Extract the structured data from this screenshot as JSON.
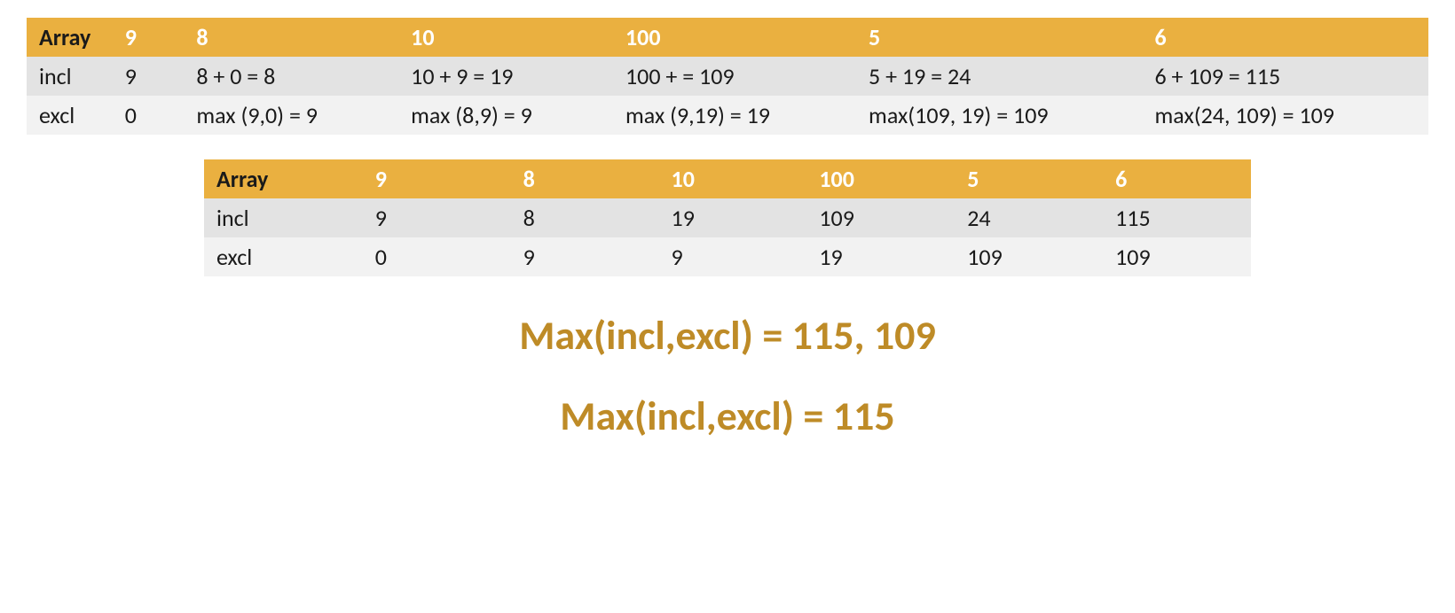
{
  "table1": {
    "header": [
      "Array",
      "9",
      "8",
      "10",
      "100",
      "5",
      "6"
    ],
    "rows": [
      [
        "incl",
        "9",
        "8 + 0 = 8",
        "10 + 9 = 19",
        "100 +  = 109",
        "5 + 19 = 24",
        "6 + 109 = 115"
      ],
      [
        "excl",
        "0",
        "max (9,0) = 9",
        "max (8,9) = 9",
        "max (9,19) = 19",
        "max(109, 19) = 109",
        "max(24, 109) = 109"
      ]
    ]
  },
  "table2": {
    "header": [
      "Array",
      "9",
      "8",
      "10",
      "100",
      "5",
      "6"
    ],
    "rows": [
      [
        "incl",
        "9",
        "8",
        "19",
        "109",
        "24",
        "115"
      ],
      [
        "excl",
        "0",
        "9",
        "9",
        "19",
        "109",
        "109"
      ]
    ]
  },
  "result": {
    "line1": "Max(incl,excl) = 115, 109",
    "line2": "Max(incl,excl) = 115"
  }
}
